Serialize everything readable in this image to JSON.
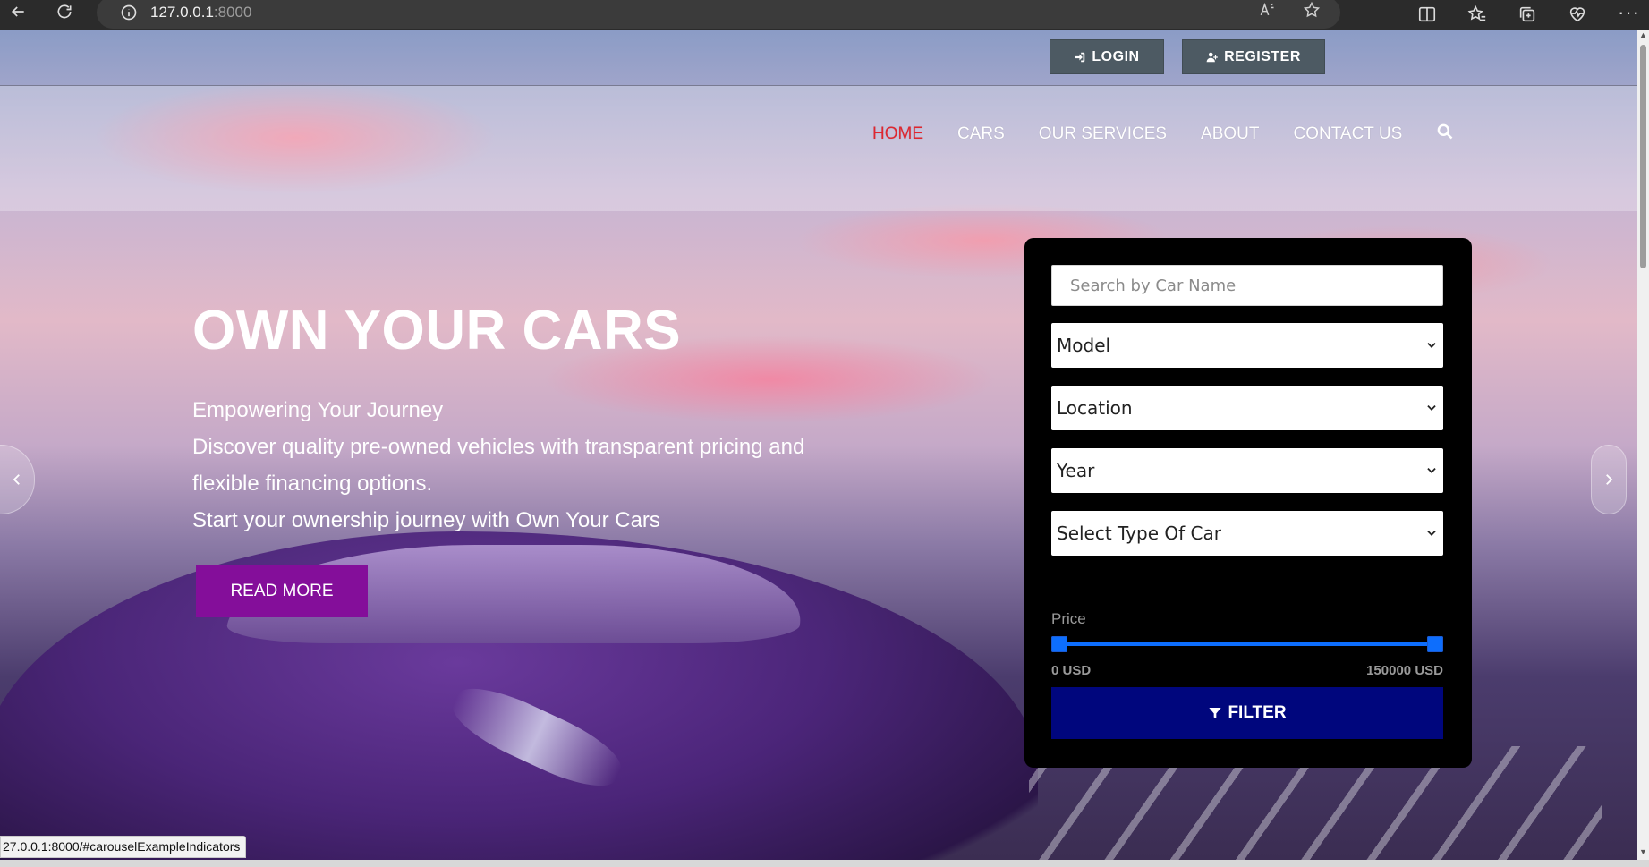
{
  "browser": {
    "url_host": "127.0.0.1",
    "url_port": ":8000",
    "status_url": "27.0.0.1:8000/#carouselExampleIndicators"
  },
  "header": {
    "login_label": "LOGIN",
    "register_label": "REGISTER",
    "nav": [
      {
        "label": "HOME",
        "active": true
      },
      {
        "label": "CARS",
        "active": false
      },
      {
        "label": "OUR SERVICES",
        "active": false
      },
      {
        "label": "ABOUT",
        "active": false
      },
      {
        "label": "CONTACT US",
        "active": false
      }
    ]
  },
  "hero": {
    "title": "OWN YOUR CARS",
    "lines": [
      "Empowering Your Journey",
      "Discover quality pre-owned vehicles with transparent pricing and",
      "flexible financing options.",
      "Start your ownership journey with Own Your Cars"
    ],
    "cta_label": "READ MORE"
  },
  "filter": {
    "search_placeholder": "Search by Car Name",
    "selects": [
      {
        "value": "Model"
      },
      {
        "value": "Location"
      },
      {
        "value": "Year"
      },
      {
        "value": "Select Type Of Car"
      }
    ],
    "price_label": "Price",
    "price_min_label": "0 USD",
    "price_max_label": "150000 USD",
    "price_range_low_fraction": 0.0,
    "price_range_high_fraction": 1.0,
    "button_label": "FILTER"
  },
  "colors": {
    "nav_active": "#e0262f",
    "cta": "#840e9a",
    "filter_button": "#00067d",
    "slider": "#0d6efd",
    "auth_button": "#4d5a63"
  },
  "icons": {
    "login": "sign-in-icon",
    "register": "user-plus-icon",
    "search": "search-icon",
    "filter": "filter-icon",
    "prev": "chevron-left-icon",
    "next": "chevron-right-icon"
  }
}
